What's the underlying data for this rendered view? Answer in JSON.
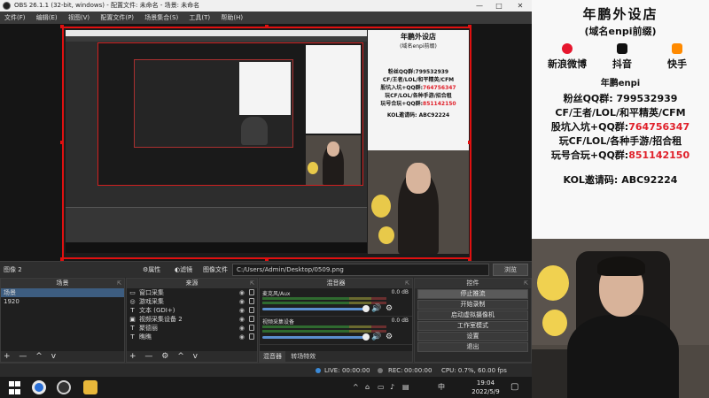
{
  "window": {
    "title": "OBS 26.1.1 (32-bit, windows) - 配置文件: 未命名 - 场景: 未命名",
    "controls": [
      "—",
      "□",
      "✕"
    ]
  },
  "menu": [
    "文件(F)",
    "编辑(E)",
    "视图(V)",
    "配置文件(P)",
    "场景集合(S)",
    "工具(T)",
    "帮助(H)"
  ],
  "source_toolbar": {
    "current_source": "图像 2",
    "properties": "属性",
    "filters": "滤镜",
    "image_file_label": "图像文件",
    "path": "C:/Users/Admin/Desktop/0509.png",
    "browse": "浏览"
  },
  "scenes": {
    "header": "场景",
    "items": [
      {
        "label": "场景",
        "selected": true
      },
      {
        "label": "1920",
        "selected": false
      }
    ],
    "footer_icons": [
      "+",
      "—",
      "^",
      "v"
    ]
  },
  "sources": {
    "header": "来源",
    "items": [
      {
        "icon": "window-capture-icon",
        "glyph": "▭",
        "label": "窗口采集"
      },
      {
        "icon": "game-capture-icon",
        "glyph": "◎",
        "label": "游戏采集"
      },
      {
        "icon": "text-icon",
        "glyph": "T",
        "label": "文本 (GDI+)"
      },
      {
        "icon": "video-capture-icon",
        "glyph": "▣",
        "label": "视频采集设备 2"
      },
      {
        "icon": "text-icon",
        "glyph": "T",
        "label": "聚德丽"
      },
      {
        "icon": "text-icon",
        "glyph": "T",
        "label": "瞧瞧"
      }
    ],
    "footer_icons": [
      "+",
      "—",
      "⚙",
      "^",
      "v"
    ]
  },
  "mixer": {
    "header": "混音器",
    "channels": [
      {
        "name": "麦克风/Aux",
        "db": "0.0 dB"
      },
      {
        "name": "视频采集设备",
        "db": "0.0 dB"
      }
    ],
    "tabs": [
      "混音器",
      "转场特效"
    ]
  },
  "controls": {
    "header": "控件",
    "buttons": [
      {
        "label": "停止推流",
        "active": true
      },
      {
        "label": "开始录制",
        "active": false
      },
      {
        "label": "启动虚拟摄像机",
        "active": false
      },
      {
        "label": "工作室模式",
        "active": false
      },
      {
        "label": "设置",
        "active": false
      },
      {
        "label": "退出",
        "active": false
      }
    ]
  },
  "status": {
    "live_label": "LIVE:",
    "live_time": "00:00:00",
    "rec_label": "REC:",
    "rec_time": "00:00:00",
    "cpu": "CPU: 0.7%, 60.00 fps"
  },
  "taskbar": {
    "time": "19:04",
    "date": "2022/5/9",
    "ime": "中",
    "tray_icons": [
      "^",
      "⌂",
      "▭",
      "♪",
      "▤"
    ]
  },
  "overlay": {
    "title": "年鹏外设店",
    "subtitle": "(域名enpi前缀)",
    "social": [
      {
        "label": "新浪微博",
        "icon": "weibo-icon",
        "color": "#e6162d"
      },
      {
        "label": "抖音",
        "icon": "douyin-icon",
        "color": "#111111"
      },
      {
        "label": "快手",
        "icon": "kuaishou-icon",
        "color": "#ff8a00"
      }
    ],
    "brand": "年鹏enpi",
    "fan_qq_label": "粉丝QQ群:",
    "fan_qq_number": "799532939",
    "games_1": "CF/王者/LOL/和平精英/CFM",
    "group_1_label": "股坑入坑+QQ群:",
    "group_1_number": "764756347",
    "games_2": "玩CF/LOL/各种手游/招合租",
    "group_2_label": "玩号合玩+QQ群:",
    "group_2_number": "851142150",
    "kol_label": "KOL邀请码:",
    "kol_code": "ABC92224"
  },
  "colors": {
    "accent_red": "#e0202a",
    "selection": "#3d5d80",
    "obs_bg": "#2b2b2b"
  }
}
